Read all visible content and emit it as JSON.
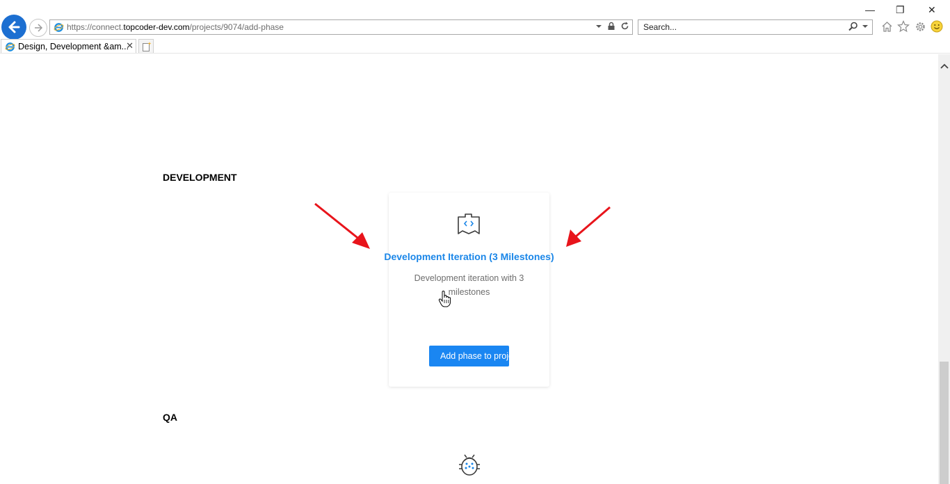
{
  "browser": {
    "url_prefix": "https://connect.",
    "url_domain": "topcoder-dev.com",
    "url_path": "/projects/9074/add-phase",
    "search_placeholder": "Search...",
    "tab_title": "Design, Development &am...",
    "tab_close": "✕",
    "window_controls": {
      "minimize": "—",
      "restore": "❐",
      "close": "✕"
    }
  },
  "page": {
    "sections": [
      {
        "title": "DEVELOPMENT"
      },
      {
        "title": "QA"
      }
    ],
    "card": {
      "icon": "code-document-icon",
      "title": "Development Iteration (3 Milestones)",
      "description": "Development iteration with 3 milestones",
      "button_label": "Add phase to project"
    },
    "qa_icon": "bug-icon"
  },
  "colors": {
    "accent": "#1a86f2",
    "title_blue": "#1a86e8",
    "annotation_arrow": "#e8141b",
    "ie_back": "#1c6fd1"
  }
}
